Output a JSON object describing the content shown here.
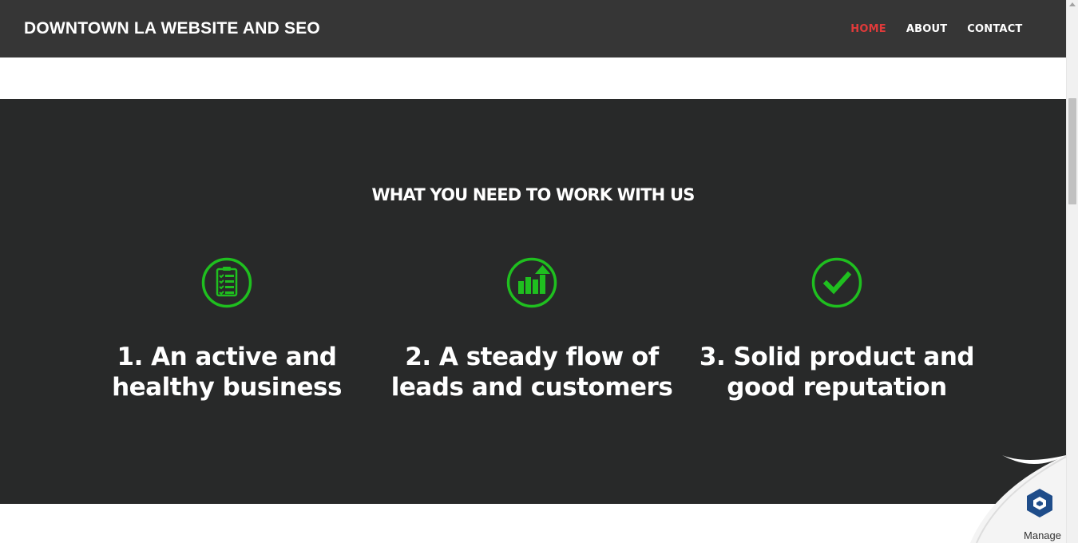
{
  "header": {
    "brand": "DOWNTOWN LA WEBSITE AND SEO",
    "nav": [
      {
        "label": "HOME",
        "active": true
      },
      {
        "label": "ABOUT",
        "active": false
      },
      {
        "label": "CONTACT",
        "active": false
      }
    ]
  },
  "section": {
    "title": "WHAT YOU NEED TO WORK WITH US",
    "features": [
      {
        "icon": "clipboard-checklist-icon",
        "line1": "1. An active and",
        "line2": "healthy business"
      },
      {
        "icon": "growth-chart-icon",
        "line1": "2. A steady flow of",
        "line2": "leads and customers"
      },
      {
        "icon": "checkmark-icon",
        "line1": "3. Solid product and",
        "line2": "good reputation"
      }
    ]
  },
  "widget": {
    "label": "Manage"
  },
  "colors": {
    "accent": "#1fbf1f",
    "active_nav": "#e03a3a",
    "navbar_bg": "#363636",
    "section_bg": "#282929"
  }
}
